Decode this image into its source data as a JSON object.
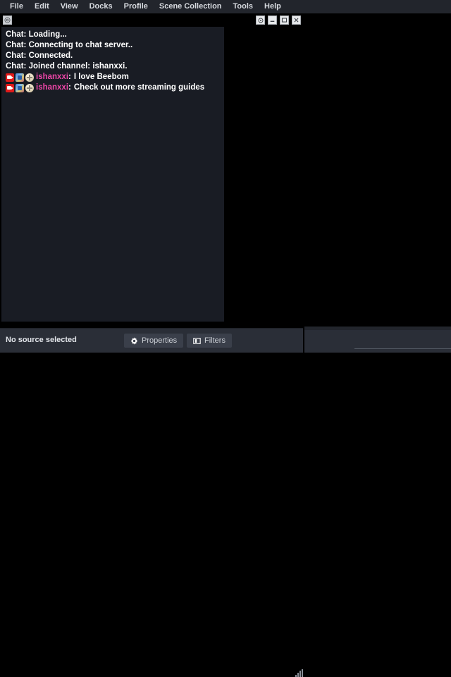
{
  "menubar": {
    "items": [
      {
        "label": "File",
        "name": "menu-file"
      },
      {
        "label": "Edit",
        "name": "menu-edit"
      },
      {
        "label": "View",
        "name": "menu-view"
      },
      {
        "label": "Docks",
        "name": "menu-docks"
      },
      {
        "label": "Profile",
        "name": "menu-profile"
      },
      {
        "label": "Scene Collection",
        "name": "menu-scene-collection"
      },
      {
        "label": "Tools",
        "name": "menu-tools"
      },
      {
        "label": "Help",
        "name": "menu-help"
      }
    ]
  },
  "dock": {
    "menu_icon": "gear-icon",
    "window_buttons": [
      {
        "name": "dock-settings-button",
        "icon": "gear-icon"
      },
      {
        "name": "dock-minimize-button",
        "icon": "minimize-icon"
      },
      {
        "name": "dock-maximize-button",
        "icon": "maximize-icon"
      },
      {
        "name": "dock-close-button",
        "icon": "close-icon"
      }
    ]
  },
  "chat": {
    "username_color": "#ef46a8",
    "text_color": "#ffffff",
    "background_color": "#191c24",
    "lines": [
      {
        "type": "system",
        "text": "Chat: Loading..."
      },
      {
        "type": "system",
        "text": "Chat: Connecting to chat server.."
      },
      {
        "type": "system",
        "text": "Chat: Connected."
      },
      {
        "type": "system",
        "text": "Chat: Joined channel: ishanxxi."
      },
      {
        "type": "message",
        "badges": [
          "broadcaster-badge",
          "subscriber-badge",
          "coin-badge"
        ],
        "user": "ishanxxi",
        "separator": ":",
        "text": "I love Beebom"
      },
      {
        "type": "message",
        "badges": [
          "broadcaster-badge",
          "subscriber-badge",
          "coin-badge"
        ],
        "user": "ishanxxi",
        "separator": ":",
        "text": "Check out more streaming guides"
      }
    ]
  },
  "bottom_bar": {
    "status": "No source selected",
    "properties_label": "Properties",
    "properties_icon": "gear-icon",
    "filters_label": "Filters",
    "filters_icon": "panels-icon",
    "resize_grip": "resize-grip-icon"
  }
}
